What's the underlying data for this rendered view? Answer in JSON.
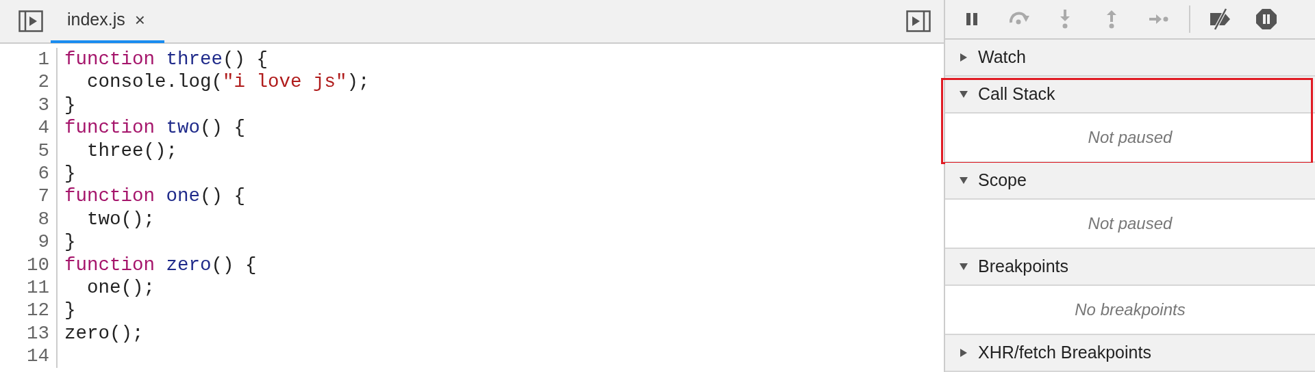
{
  "editor": {
    "tabs": [
      {
        "label": "index.js",
        "close": "×",
        "selected": true
      }
    ],
    "code": [
      {
        "number": "1",
        "tokens": [
          {
            "text": "function ",
            "kind": "keyword"
          },
          {
            "text": "three",
            "kind": "def"
          },
          {
            "text": "() {",
            "kind": "plain"
          }
        ]
      },
      {
        "number": "2",
        "tokens": [
          {
            "text": "  console.log(",
            "kind": "plain"
          },
          {
            "text": "\"i love js\"",
            "kind": "string"
          },
          {
            "text": ");",
            "kind": "plain"
          }
        ]
      },
      {
        "number": "3",
        "tokens": [
          {
            "text": "}",
            "kind": "plain"
          }
        ]
      },
      {
        "number": "4",
        "tokens": [
          {
            "text": "function ",
            "kind": "keyword"
          },
          {
            "text": "two",
            "kind": "def"
          },
          {
            "text": "() {",
            "kind": "plain"
          }
        ]
      },
      {
        "number": "5",
        "tokens": [
          {
            "text": "  three();",
            "kind": "plain"
          }
        ]
      },
      {
        "number": "6",
        "tokens": [
          {
            "text": "}",
            "kind": "plain"
          }
        ]
      },
      {
        "number": "7",
        "tokens": [
          {
            "text": "function ",
            "kind": "keyword"
          },
          {
            "text": "one",
            "kind": "def"
          },
          {
            "text": "() {",
            "kind": "plain"
          }
        ]
      },
      {
        "number": "8",
        "tokens": [
          {
            "text": "  two();",
            "kind": "plain"
          }
        ]
      },
      {
        "number": "9",
        "tokens": [
          {
            "text": "}",
            "kind": "plain"
          }
        ]
      },
      {
        "number": "10",
        "tokens": [
          {
            "text": "function ",
            "kind": "keyword"
          },
          {
            "text": "zero",
            "kind": "def"
          },
          {
            "text": "() {",
            "kind": "plain"
          }
        ]
      },
      {
        "number": "11",
        "tokens": [
          {
            "text": "  one();",
            "kind": "plain"
          }
        ]
      },
      {
        "number": "12",
        "tokens": [
          {
            "text": "}",
            "kind": "plain"
          }
        ]
      },
      {
        "number": "13",
        "tokens": [
          {
            "text": "zero();",
            "kind": "plain"
          }
        ]
      },
      {
        "number": "14"
      }
    ]
  },
  "debugger": {
    "toolbar": [
      {
        "kind": "pause",
        "disabled": false
      },
      {
        "kind": "step-over",
        "disabled": true
      },
      {
        "kind": "step-into",
        "disabled": true
      },
      {
        "kind": "step-out",
        "disabled": true
      },
      {
        "kind": "step",
        "disabled": true
      },
      {
        "kind": "deactivate",
        "disabled": false
      },
      {
        "kind": "pause-exceptions",
        "disabled": false
      }
    ],
    "sections": [
      {
        "title": "Watch",
        "expanded": false,
        "highlighted": false
      },
      {
        "title": "Call Stack",
        "expanded": true,
        "highlighted": true,
        "message": "Not paused"
      },
      {
        "title": "Scope",
        "expanded": true,
        "highlighted": false,
        "message": "Not paused"
      },
      {
        "title": "Breakpoints",
        "expanded": true,
        "highlighted": false,
        "message": "No breakpoints"
      },
      {
        "title": "XHR/fetch Breakpoints",
        "expanded": false,
        "highlighted": false
      }
    ]
  }
}
